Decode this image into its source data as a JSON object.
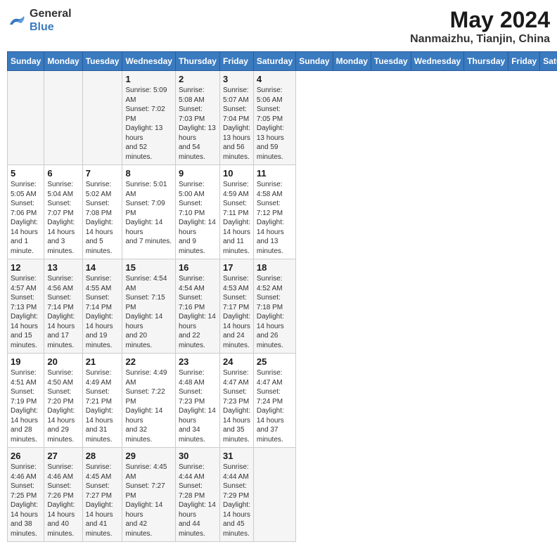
{
  "header": {
    "logo_line1": "General",
    "logo_line2": "Blue",
    "month_year": "May 2024",
    "location": "Nanmaizhu, Tianjin, China"
  },
  "days_of_week": [
    "Sunday",
    "Monday",
    "Tuesday",
    "Wednesday",
    "Thursday",
    "Friday",
    "Saturday"
  ],
  "weeks": [
    [
      {
        "day": "",
        "info": ""
      },
      {
        "day": "",
        "info": ""
      },
      {
        "day": "",
        "info": ""
      },
      {
        "day": "1",
        "info": "Sunrise: 5:09 AM\nSunset: 7:02 PM\nDaylight: 13 hours\nand 52 minutes."
      },
      {
        "day": "2",
        "info": "Sunrise: 5:08 AM\nSunset: 7:03 PM\nDaylight: 13 hours\nand 54 minutes."
      },
      {
        "day": "3",
        "info": "Sunrise: 5:07 AM\nSunset: 7:04 PM\nDaylight: 13 hours\nand 56 minutes."
      },
      {
        "day": "4",
        "info": "Sunrise: 5:06 AM\nSunset: 7:05 PM\nDaylight: 13 hours\nand 59 minutes."
      }
    ],
    [
      {
        "day": "5",
        "info": "Sunrise: 5:05 AM\nSunset: 7:06 PM\nDaylight: 14 hours\nand 1 minute."
      },
      {
        "day": "6",
        "info": "Sunrise: 5:04 AM\nSunset: 7:07 PM\nDaylight: 14 hours\nand 3 minutes."
      },
      {
        "day": "7",
        "info": "Sunrise: 5:02 AM\nSunset: 7:08 PM\nDaylight: 14 hours\nand 5 minutes."
      },
      {
        "day": "8",
        "info": "Sunrise: 5:01 AM\nSunset: 7:09 PM\nDaylight: 14 hours\nand 7 minutes."
      },
      {
        "day": "9",
        "info": "Sunrise: 5:00 AM\nSunset: 7:10 PM\nDaylight: 14 hours\nand 9 minutes."
      },
      {
        "day": "10",
        "info": "Sunrise: 4:59 AM\nSunset: 7:11 PM\nDaylight: 14 hours\nand 11 minutes."
      },
      {
        "day": "11",
        "info": "Sunrise: 4:58 AM\nSunset: 7:12 PM\nDaylight: 14 hours\nand 13 minutes."
      }
    ],
    [
      {
        "day": "12",
        "info": "Sunrise: 4:57 AM\nSunset: 7:13 PM\nDaylight: 14 hours\nand 15 minutes."
      },
      {
        "day": "13",
        "info": "Sunrise: 4:56 AM\nSunset: 7:14 PM\nDaylight: 14 hours\nand 17 minutes."
      },
      {
        "day": "14",
        "info": "Sunrise: 4:55 AM\nSunset: 7:14 PM\nDaylight: 14 hours\nand 19 minutes."
      },
      {
        "day": "15",
        "info": "Sunrise: 4:54 AM\nSunset: 7:15 PM\nDaylight: 14 hours\nand 20 minutes."
      },
      {
        "day": "16",
        "info": "Sunrise: 4:54 AM\nSunset: 7:16 PM\nDaylight: 14 hours\nand 22 minutes."
      },
      {
        "day": "17",
        "info": "Sunrise: 4:53 AM\nSunset: 7:17 PM\nDaylight: 14 hours\nand 24 minutes."
      },
      {
        "day": "18",
        "info": "Sunrise: 4:52 AM\nSunset: 7:18 PM\nDaylight: 14 hours\nand 26 minutes."
      }
    ],
    [
      {
        "day": "19",
        "info": "Sunrise: 4:51 AM\nSunset: 7:19 PM\nDaylight: 14 hours\nand 28 minutes."
      },
      {
        "day": "20",
        "info": "Sunrise: 4:50 AM\nSunset: 7:20 PM\nDaylight: 14 hours\nand 29 minutes."
      },
      {
        "day": "21",
        "info": "Sunrise: 4:49 AM\nSunset: 7:21 PM\nDaylight: 14 hours\nand 31 minutes."
      },
      {
        "day": "22",
        "info": "Sunrise: 4:49 AM\nSunset: 7:22 PM\nDaylight: 14 hours\nand 32 minutes."
      },
      {
        "day": "23",
        "info": "Sunrise: 4:48 AM\nSunset: 7:23 PM\nDaylight: 14 hours\nand 34 minutes."
      },
      {
        "day": "24",
        "info": "Sunrise: 4:47 AM\nSunset: 7:23 PM\nDaylight: 14 hours\nand 35 minutes."
      },
      {
        "day": "25",
        "info": "Sunrise: 4:47 AM\nSunset: 7:24 PM\nDaylight: 14 hours\nand 37 minutes."
      }
    ],
    [
      {
        "day": "26",
        "info": "Sunrise: 4:46 AM\nSunset: 7:25 PM\nDaylight: 14 hours\nand 38 minutes."
      },
      {
        "day": "27",
        "info": "Sunrise: 4:46 AM\nSunset: 7:26 PM\nDaylight: 14 hours\nand 40 minutes."
      },
      {
        "day": "28",
        "info": "Sunrise: 4:45 AM\nSunset: 7:27 PM\nDaylight: 14 hours\nand 41 minutes."
      },
      {
        "day": "29",
        "info": "Sunrise: 4:45 AM\nSunset: 7:27 PM\nDaylight: 14 hours\nand 42 minutes."
      },
      {
        "day": "30",
        "info": "Sunrise: 4:44 AM\nSunset: 7:28 PM\nDaylight: 14 hours\nand 44 minutes."
      },
      {
        "day": "31",
        "info": "Sunrise: 4:44 AM\nSunset: 7:29 PM\nDaylight: 14 hours\nand 45 minutes."
      },
      {
        "day": "",
        "info": ""
      }
    ]
  ]
}
